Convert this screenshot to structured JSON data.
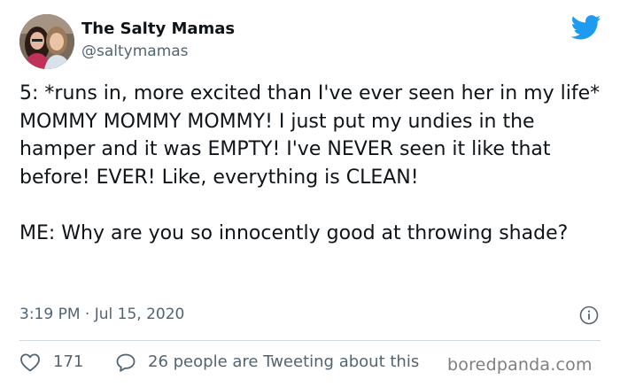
{
  "author": {
    "display_name": "The Salty Mamas",
    "handle": "@saltymamas",
    "avatar_icon": "profile-photo"
  },
  "tweet": {
    "paragraphs": [
      "5: *runs in, more excited than I've ever seen her in my life* MOMMY MOMMY MOMMY! I just put my undies in the hamper and it was EMPTY! I've NEVER seen it like that before! EVER! Like, everything is CLEAN!",
      "ME: Why are you so innocently good at throwing shade?"
    ],
    "timestamp": "3:19 PM · Jul 15, 2020"
  },
  "stats": {
    "likes": "171",
    "tweeting_about": "26 people are Tweeting about this"
  },
  "watermark": "boredpanda.com",
  "colors": {
    "twitter_blue": "#1d9bf0",
    "text_primary": "#0f1419",
    "text_secondary": "#536471",
    "divider": "#cfd9de"
  },
  "icons": {
    "brand": "twitter-bird-icon",
    "info": "info-icon",
    "like": "heart-icon",
    "reply": "speech-bubble-icon"
  }
}
